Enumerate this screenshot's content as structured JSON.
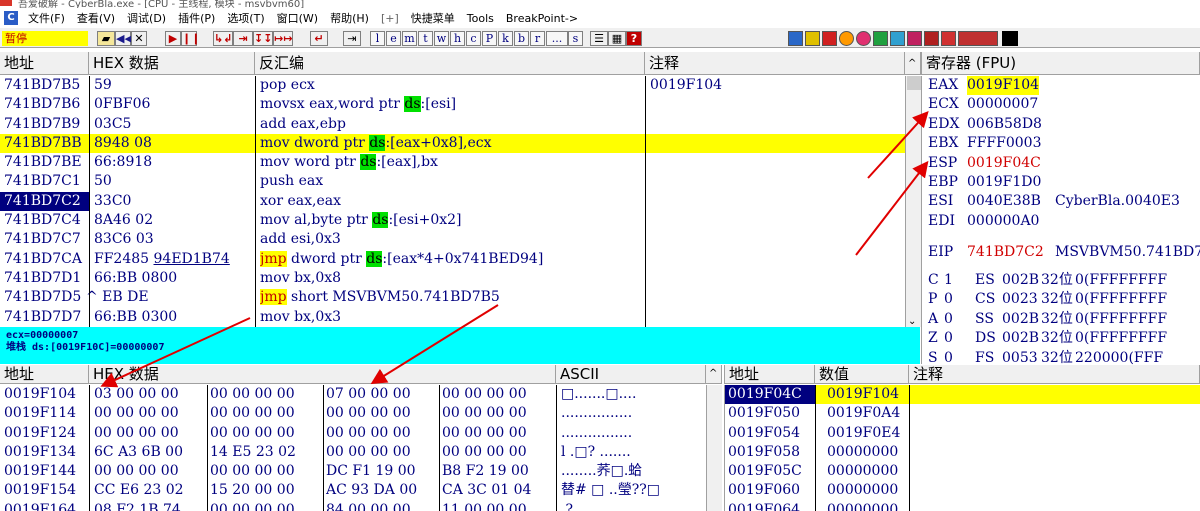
{
  "title": "吾爱破解 - CyberBla.exe - [CPU - 主线程, 模块 - msvbvm60]",
  "menu": [
    "文件(F)",
    "查看(V)",
    "调试(D)",
    "插件(P)",
    "选项(T)",
    "窗口(W)",
    "帮助(H)",
    "[+]",
    "快捷菜单",
    "Tools",
    "BreakPoint->"
  ],
  "toolbar": {
    "status": "暂停",
    "letters": [
      "l",
      "e",
      "m",
      "t",
      "w",
      "h",
      "c",
      "P",
      "k",
      "b",
      "r",
      "...",
      "s"
    ]
  },
  "disasm": {
    "headers": [
      "地址",
      "HEX 数据",
      "反汇编",
      "注释"
    ],
    "rows": [
      {
        "addr": "741BD7B5",
        "hex": "59",
        "asm": "pop ecx",
        "comment": "0019F104"
      },
      {
        "addr": "741BD7B6",
        "hex": "0FBF06",
        "asm": "movsx eax,word ptr ",
        "ds": "ds",
        "asm2": ":[esi]"
      },
      {
        "addr": "741BD7B9",
        "hex": "03C5",
        "asm": "add eax,ebp"
      },
      {
        "addr": "741BD7BB",
        "hex": "8948 08",
        "asm": "mov dword ptr ",
        "ds": "ds",
        "asm2": ":[eax+0x8],ecx"
      },
      {
        "addr": "741BD7BE",
        "hex": "66:8918",
        "asm": "mov word ptr ",
        "ds": "ds",
        "asm2": ":[eax],bx"
      },
      {
        "addr": "741BD7C1",
        "hex": "50",
        "asm": "push eax"
      },
      {
        "addr": "741BD7C2",
        "hex": "33C0",
        "asm": "xor eax,eax"
      },
      {
        "addr": "741BD7C4",
        "hex": "8A46 02",
        "asm": "mov al,byte ptr ",
        "ds": "ds",
        "asm2": ":[esi+0x2]"
      },
      {
        "addr": "741BD7C7",
        "hex": "83C6 03",
        "asm": "add esi,0x3"
      },
      {
        "addr": "741BD7CA",
        "hex": "FF2485 94ED1B74",
        "jmp": "jmp",
        "asm": " dword ptr ",
        "ds": "ds",
        "asm2": ":[eax*4+0x741BED94]"
      },
      {
        "addr": "741BD7D1",
        "hex": "66:BB 0800",
        "asm": "mov bx,0x8"
      },
      {
        "addr": "741BD7D5",
        "hex": "^ EB DE",
        "jmp": "jmp",
        "asm": " short MSVBVM50.741BD7B5"
      },
      {
        "addr": "741BD7D7",
        "hex": "66:BB 0300",
        "asm": "mov bx,0x3"
      }
    ]
  },
  "info": {
    "line1": "ecx=00000007",
    "line2": "堆栈 ds:[0019F10C]=00000007"
  },
  "registers": {
    "header": "寄存器 (FPU)",
    "gp": [
      {
        "name": "EAX",
        "value": "0019F104",
        "highlight": "yellow"
      },
      {
        "name": "ECX",
        "value": "00000007"
      },
      {
        "name": "EDX",
        "value": "006B58D8"
      },
      {
        "name": "EBX",
        "value": "FFFF0003"
      },
      {
        "name": "ESP",
        "value": "0019F04C",
        "highlight": "red"
      },
      {
        "name": "EBP",
        "value": "0019F1D0"
      },
      {
        "name": "ESI",
        "value": "0040E38B",
        "extra": "CyberBla.0040E3"
      },
      {
        "name": "EDI",
        "value": "000000A0"
      }
    ],
    "eip": {
      "name": "EIP",
      "value": "741BD7C2",
      "extra": "MSVBVM50.741BD7"
    },
    "flags": [
      {
        "f": "C",
        "v": "1",
        "seg": "ES",
        "sv": "002B",
        "bits": "32位",
        "rest": "0(FFFFFFFF"
      },
      {
        "f": "P",
        "v": "0",
        "seg": "CS",
        "sv": "0023",
        "bits": "32位",
        "rest": "0(FFFFFFFF"
      },
      {
        "f": "A",
        "v": "0",
        "seg": "SS",
        "sv": "002B",
        "bits": "32位",
        "rest": "0(FFFFFFFF"
      },
      {
        "f": "Z",
        "v": "0",
        "seg": "DS",
        "sv": "002B",
        "bits": "32位",
        "rest": "0(FFFFFFFF"
      },
      {
        "f": "S",
        "v": "0",
        "seg": "FS",
        "sv": "0053",
        "bits": "32位",
        "rest": "220000(FFF"
      }
    ]
  },
  "dump": {
    "headers": [
      "地址",
      "HEX 数据",
      "ASCII"
    ],
    "rows": [
      {
        "addr": "0019F104",
        "hex": [
          "03 00 00 00",
          "00 00 00 00",
          "07 00 00 00",
          "00 00 00 00"
        ],
        "ascii": "□.......□...."
      },
      {
        "addr": "0019F114",
        "hex": [
          "00 00 00 00",
          "00 00 00 00",
          "00 00 00 00",
          "00 00 00 00"
        ],
        "ascii": "................"
      },
      {
        "addr": "0019F124",
        "hex": [
          "00 00 00 00",
          "00 00 00 00",
          "00 00 00 00",
          "00 00 00 00"
        ],
        "ascii": "................"
      },
      {
        "addr": "0019F134",
        "hex": [
          "6C A3 6B 00",
          "14 E5 23 02",
          "00 00 00 00",
          "00 00 00 00"
        ],
        "ascii": "l  .□?  ......."
      },
      {
        "addr": "0019F144",
        "hex": [
          "00 00 00 00",
          "00 00 00 00",
          "DC F1 19 00",
          "B8 F2 19 00"
        ],
        "ascii": "........荞□.蛤"
      },
      {
        "addr": "0019F154",
        "hex": [
          "CC E6 23 02",
          "15 20 00 00",
          "AC 93 DA 00",
          "CA 3C 01 04"
        ],
        "ascii": "替# □ ..瑩??□"
      },
      {
        "addr": "0019F164",
        "hex": [
          "08 F2 1B 74",
          "00 00 00 00",
          "84 00 00 00",
          "11 00 00 00"
        ],
        "ascii": ".?  ..........."
      }
    ]
  },
  "stack": {
    "headers": [
      "地址",
      "数值",
      "注释"
    ],
    "rows": [
      {
        "addr": "0019F04C",
        "value": "0019F104"
      },
      {
        "addr": "0019F050",
        "value": "0019F0A4"
      },
      {
        "addr": "0019F054",
        "value": "0019F0E4"
      },
      {
        "addr": "0019F058",
        "value": "00000000"
      },
      {
        "addr": "0019F05C",
        "value": "00000000"
      },
      {
        "addr": "0019F060",
        "value": "00000000"
      },
      {
        "addr": "0019F064",
        "value": "00000000"
      }
    ]
  }
}
